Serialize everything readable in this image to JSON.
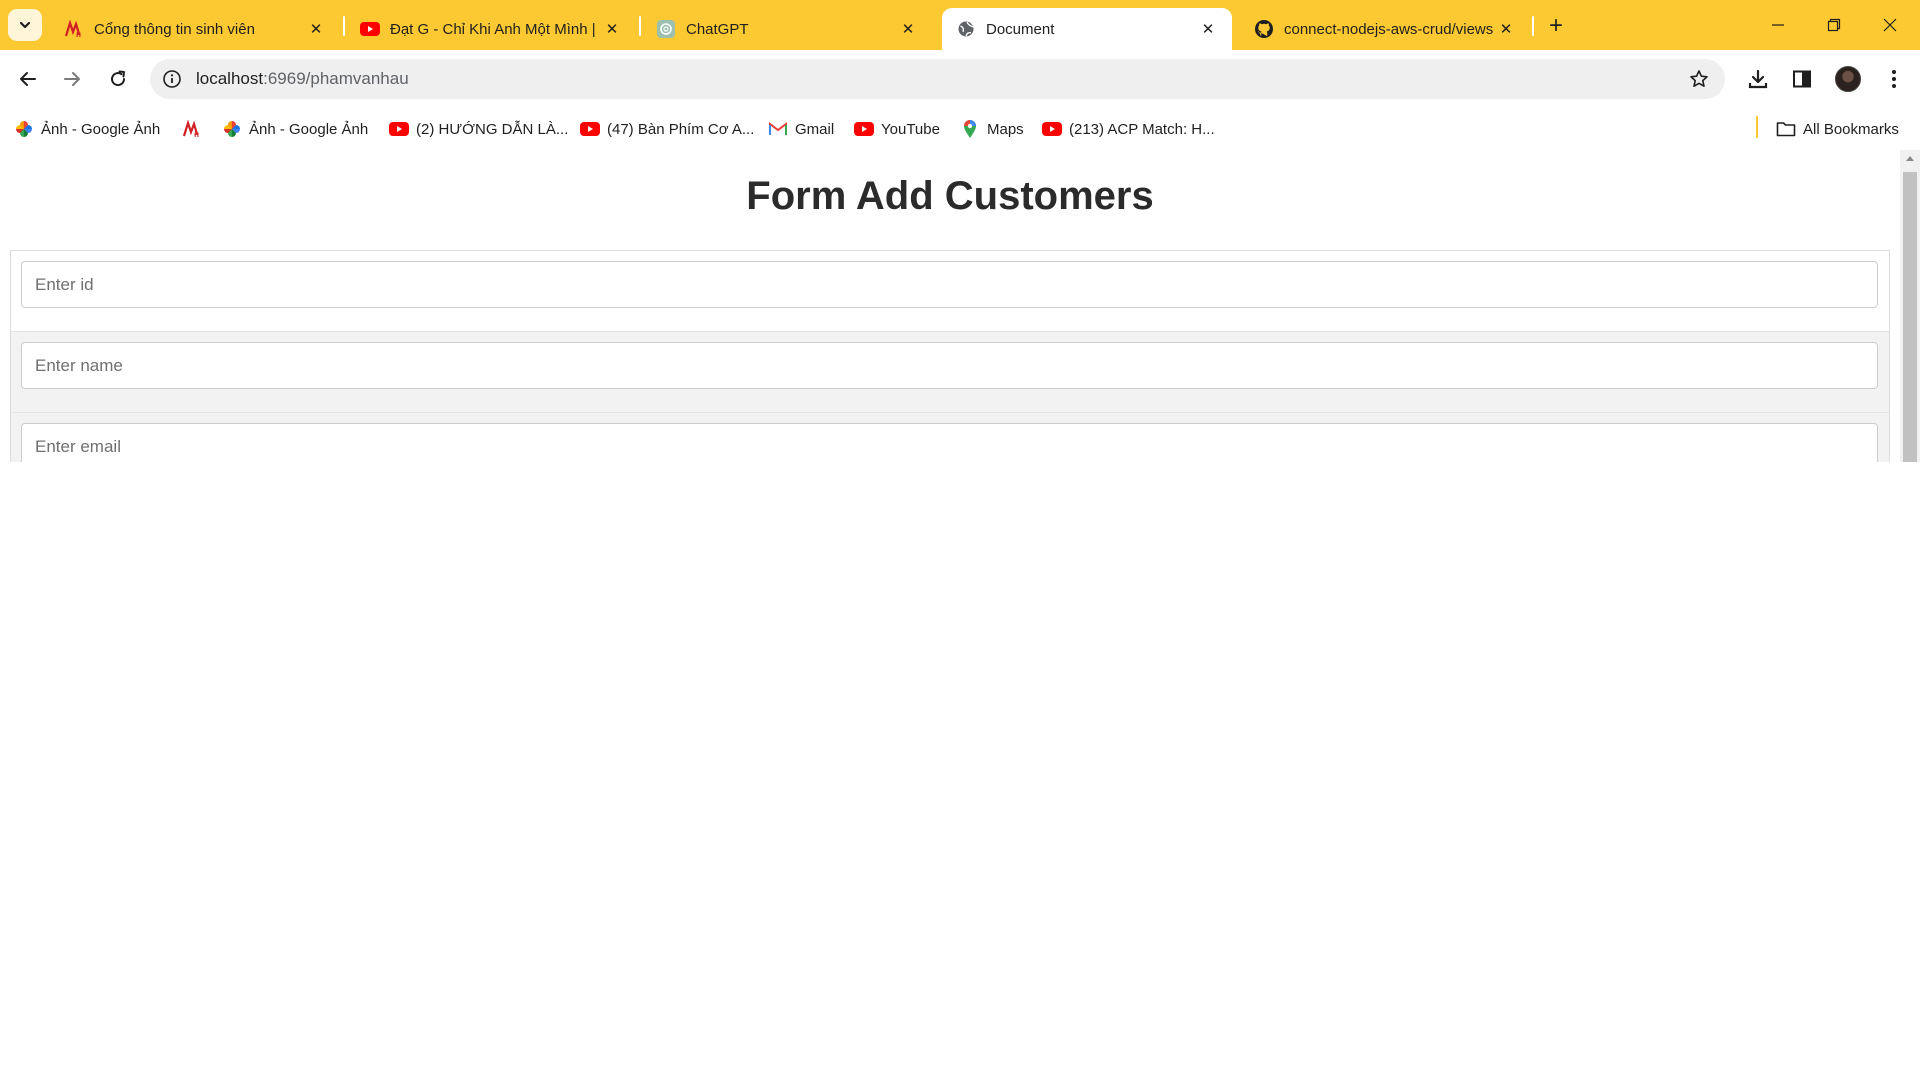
{
  "browser": {
    "tabs": [
      {
        "title": "Cổng thông tin sinh viên",
        "icon": "haui-logo-icon",
        "active": false
      },
      {
        "title": "Đạt G - Chỉ Khi Anh Một Mình |",
        "icon": "youtube-icon",
        "active": false
      },
      {
        "title": "ChatGPT",
        "icon": "chatgpt-icon",
        "active": false
      },
      {
        "title": "Document",
        "icon": "globe-icon",
        "active": true
      },
      {
        "title": "connect-nodejs-aws-crud/views",
        "icon": "github-icon",
        "active": false
      }
    ],
    "url_host": "localhost",
    "url_path": ":6969/phamvanhau",
    "bookmarks": [
      {
        "label": "Ảnh - Google Ảnh",
        "icon": "google-photos-icon"
      },
      {
        "label": "",
        "icon": "haui-logo-icon"
      },
      {
        "label": "Ảnh - Google Ảnh",
        "icon": "google-photos-icon"
      },
      {
        "label": "(2) HƯỚNG DẪN LÀ...",
        "icon": "youtube-icon"
      },
      {
        "label": "(47) Bàn Phím Cơ A...",
        "icon": "youtube-icon"
      },
      {
        "label": "Gmail",
        "icon": "gmail-icon"
      },
      {
        "label": "YouTube",
        "icon": "youtube-icon"
      },
      {
        "label": "Maps",
        "icon": "maps-icon"
      },
      {
        "label": "(213) ACP Match: H...",
        "icon": "youtube-icon"
      }
    ],
    "all_bookmarks_label": "All Bookmarks",
    "colors": {
      "theme": "#fcc933",
      "youtube": "#ff0000"
    }
  },
  "page": {
    "title": "Form Add Customers",
    "fields": [
      {
        "placeholder": "Enter id"
      },
      {
        "placeholder": "Enter name"
      },
      {
        "placeholder": "Enter email"
      }
    ]
  }
}
